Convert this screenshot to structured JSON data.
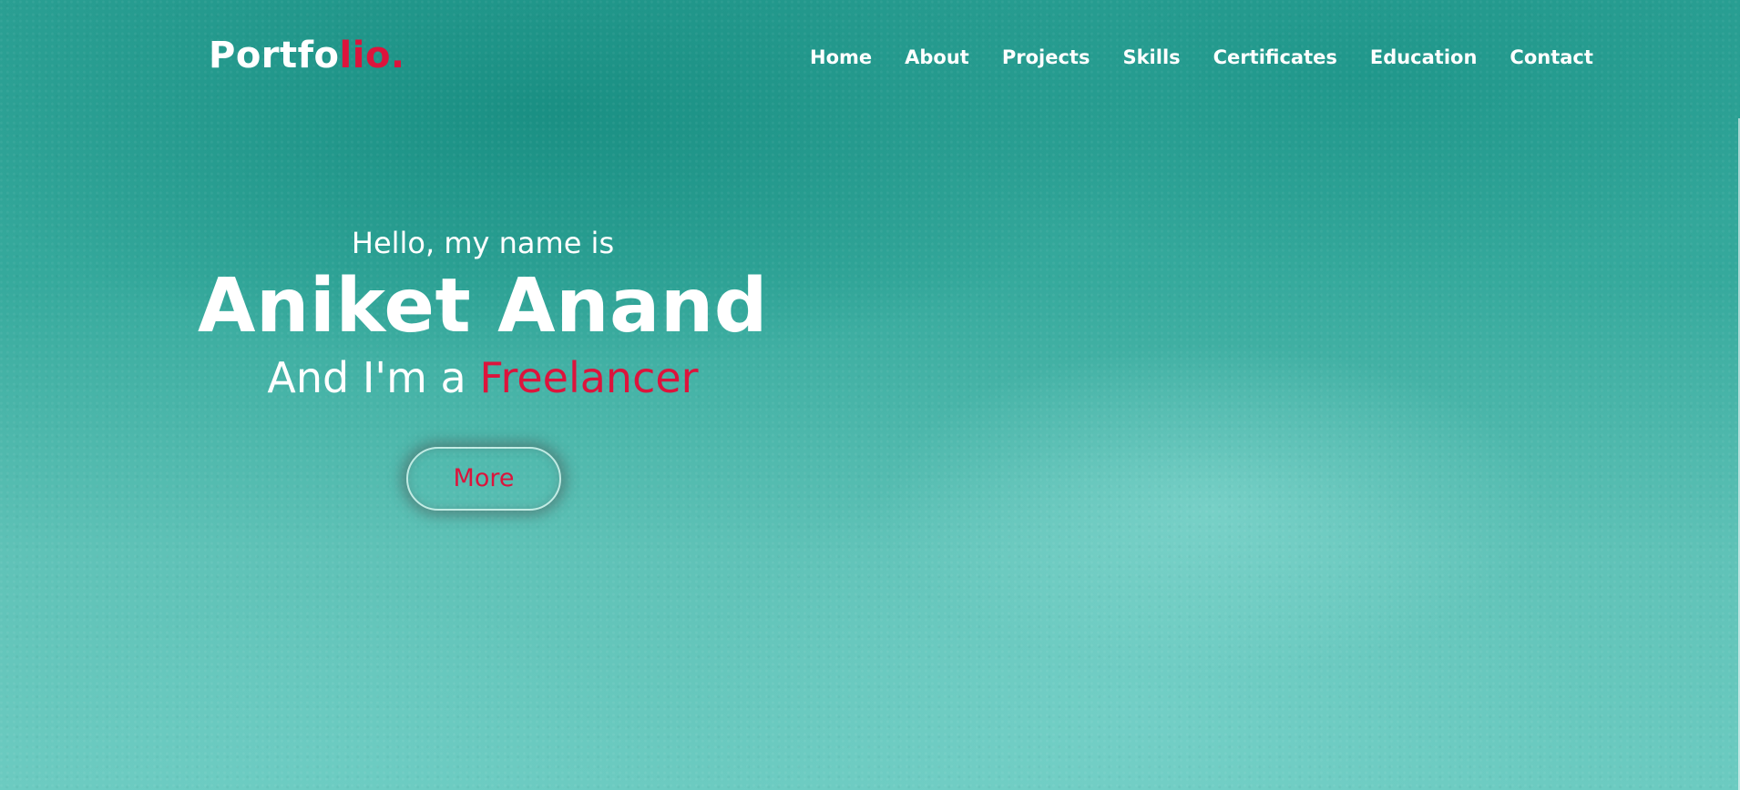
{
  "header": {
    "logo_main": "Portfo",
    "logo_accent": "lio."
  },
  "nav": {
    "items": [
      {
        "label": "Home"
      },
      {
        "label": "About"
      },
      {
        "label": "Projects"
      },
      {
        "label": "Skills"
      },
      {
        "label": "Certificates"
      },
      {
        "label": "Education"
      },
      {
        "label": "Contact"
      }
    ]
  },
  "hero": {
    "greeting": "Hello, my name is",
    "name": "Aniket Anand",
    "role_prefix": "And I'm a ",
    "role_highlight": "Freelancer",
    "button_label": "More"
  },
  "colors": {
    "accent": "#dc143c",
    "text": "#ffffff",
    "background": "#3aa99d"
  }
}
